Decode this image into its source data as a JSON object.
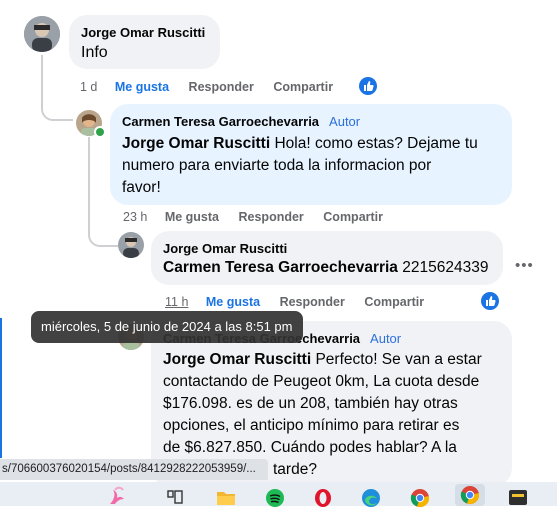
{
  "comment1": {
    "author": "Jorge Omar Ruscitti",
    "text": "Info",
    "time": "1 d",
    "like": "Me gusta",
    "reply": "Responder",
    "share": "Compartir"
  },
  "comment2": {
    "author": "Carmen Teresa Garroechevarria",
    "badge": "Autor",
    "mention": "Jorge Omar Ruscitti",
    "text_lines": [
      "Hola! como estas? Dejame tu",
      "numero para enviarte toda la informacion por",
      "favor!"
    ],
    "time": "23 h",
    "like": "Me gusta",
    "reply": "Responder",
    "share": "Compartir"
  },
  "comment3": {
    "author": "Jorge Omar Ruscitti",
    "mention": "Carmen Teresa Garroechevarria",
    "text": "2215624339",
    "time": "11 h",
    "like": "Me gusta",
    "reply": "Responder",
    "share": "Compartir",
    "more": "•••"
  },
  "comment4": {
    "author": "Carmen Teresa Garroechevarria",
    "badge": "Autor",
    "mention": "Jorge Omar Ruscitti",
    "line1": "Perfecto! Se van a estar",
    "line2": "contactando de Peugeot 0km, La cuota desde",
    "line3": "$176.098. es de un 208, también hay otras",
    "line4": "opciones, el anticipo mínimo para retirar es",
    "line5": "de $6.827.850. Cuándo podes hablar? A la",
    "line6": "tarde?"
  },
  "tooltip": "miércoles, 5 de junio de 2024 a las 8:51 pm",
  "status_url": "s/706600376020154/posts/841292822205395​9/...",
  "colors": {
    "like_blue": "#1b74e4",
    "bubble": "#f0f2f5",
    "author_bubble": "#e7f3ff",
    "muted": "#65676b"
  }
}
